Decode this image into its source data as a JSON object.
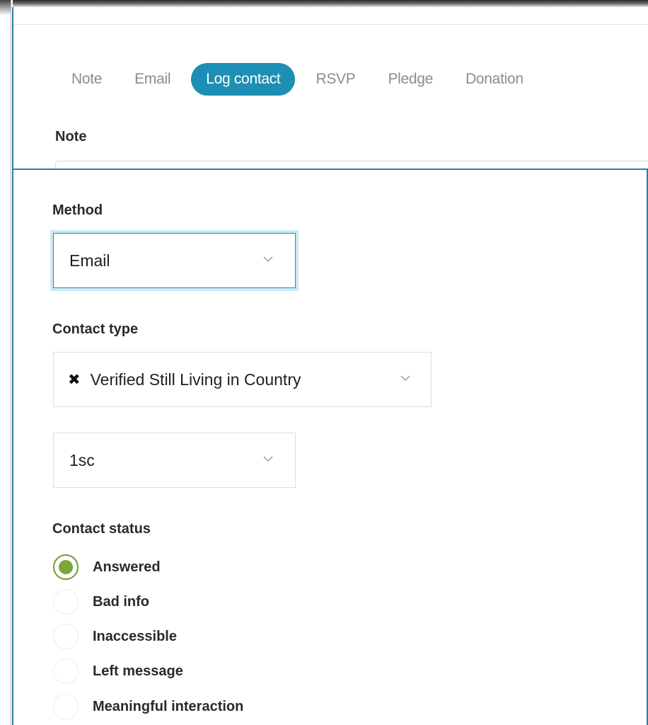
{
  "tabs": [
    {
      "label": "Note",
      "active": false
    },
    {
      "label": "Email",
      "active": false
    },
    {
      "label": "Log contact",
      "active": true
    },
    {
      "label": "RSVP",
      "active": false
    },
    {
      "label": "Pledge",
      "active": false
    },
    {
      "label": "Donation",
      "active": false
    }
  ],
  "note": {
    "label": "Note"
  },
  "method": {
    "label": "Method",
    "value": "Email",
    "icon": "chevron-down-icon"
  },
  "contact_type": {
    "label": "Contact type",
    "value": "Verified Still Living in Country",
    "remove_icon": "close-icon",
    "icon": "chevron-down-icon"
  },
  "secondary_select": {
    "value": "1sc",
    "icon": "chevron-down-icon"
  },
  "contact_status": {
    "label": "Contact status",
    "options": [
      {
        "label": "Answered",
        "checked": true
      },
      {
        "label": "Bad info",
        "checked": false
      },
      {
        "label": "Inaccessible",
        "checked": false
      },
      {
        "label": "Left message",
        "checked": false
      },
      {
        "label": "Meaningful interaction",
        "checked": false
      }
    ]
  },
  "colors": {
    "accent": "#1d8fb4",
    "frame": "#2f7fa6",
    "radio_checked": "#7aa63a",
    "tab_inactive": "#8c8c8c"
  }
}
